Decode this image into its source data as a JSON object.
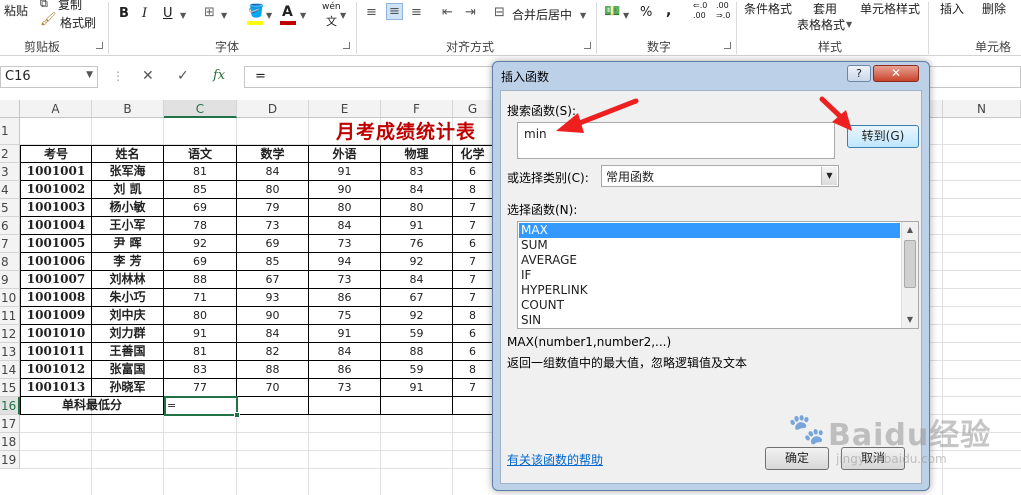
{
  "ribbon": {
    "paste_label": "粘贴",
    "copy_label": "复制",
    "format_painter_label": "格式刷",
    "groups": {
      "clipboard": "剪贴板",
      "font": "字体",
      "alignment": "对齐方式",
      "number": "数字",
      "styles": "样式",
      "cells": "单元格"
    },
    "bold": "B",
    "italic": "I",
    "underline": "U",
    "merge_center": "合并后居中",
    "percent": "%",
    "comma": ",",
    "conditional_format": "条件格式",
    "table_format_1": "套用",
    "table_format_2": "表格格式",
    "cell_styles": "单元格样式",
    "insert": "插入",
    "delete": "删除",
    "font_color_accent": "#c00000",
    "fill_color_accent": "#ffff00"
  },
  "formula_bar": {
    "name_box": "C16",
    "cancel_icon": "✕",
    "enter_icon": "✓",
    "fx_label": "fx",
    "content": "="
  },
  "sheet": {
    "columns": [
      "A",
      "B",
      "C",
      "D",
      "E",
      "F",
      "G",
      "N"
    ],
    "rows": [
      "1",
      "2",
      "3",
      "4",
      "5",
      "6",
      "7",
      "8",
      "9",
      "10",
      "11",
      "12",
      "13",
      "14",
      "15",
      "16",
      "17",
      "18",
      "19"
    ],
    "title": "月考成绩统计表",
    "headers": [
      "考号",
      "姓名",
      "语文",
      "数学",
      "外语",
      "物理",
      "化学"
    ],
    "data": [
      [
        "1001001",
        "张军海",
        "81",
        "84",
        "91",
        "83",
        "6"
      ],
      [
        "1001002",
        "刘  凯",
        "85",
        "80",
        "90",
        "84",
        "8"
      ],
      [
        "1001003",
        "杨小敏",
        "69",
        "79",
        "80",
        "80",
        "7"
      ],
      [
        "1001004",
        "王小军",
        "78",
        "73",
        "84",
        "91",
        "7"
      ],
      [
        "1001005",
        "尹  晖",
        "92",
        "69",
        "73",
        "76",
        "6"
      ],
      [
        "1001006",
        "李  芳",
        "69",
        "85",
        "94",
        "92",
        "7"
      ],
      [
        "1001007",
        "刘林林",
        "88",
        "67",
        "73",
        "84",
        "7"
      ],
      [
        "1001008",
        "朱小巧",
        "71",
        "93",
        "86",
        "67",
        "7"
      ],
      [
        "1001009",
        "刘中庆",
        "80",
        "90",
        "75",
        "92",
        "8"
      ],
      [
        "1001010",
        "刘力群",
        "91",
        "84",
        "91",
        "59",
        "6"
      ],
      [
        "1001011",
        "王善国",
        "81",
        "82",
        "84",
        "88",
        "6"
      ],
      [
        "1001012",
        "张富国",
        "83",
        "88",
        "86",
        "59",
        "8"
      ],
      [
        "1001013",
        "孙晓军",
        "77",
        "70",
        "73",
        "91",
        "7"
      ]
    ],
    "min_row_label": "单科最低分",
    "active_cell_value": "="
  },
  "dialog": {
    "title": "插入函数",
    "help_button": "?",
    "close_button": "✕",
    "search_label": "搜索函数(S):",
    "search_value": "min",
    "go_button": "转到(G)",
    "category_label": "或选择类别(C):",
    "category_value": "常用函数",
    "functions_label": "选择函数(N):",
    "functions": [
      "MAX",
      "SUM",
      "AVERAGE",
      "IF",
      "HYPERLINK",
      "COUNT",
      "SIN"
    ],
    "selected_function": "MAX",
    "signature": "MAX(number1,number2,...)",
    "description": "返回一组数值中的最大值，忽略逻辑值及文本",
    "help_link": "有关该函数的帮助",
    "ok_button": "确定",
    "cancel_button": "取消"
  },
  "watermark": {
    "brand": "Baidu经验",
    "url": "jingyan.baidu.com"
  }
}
